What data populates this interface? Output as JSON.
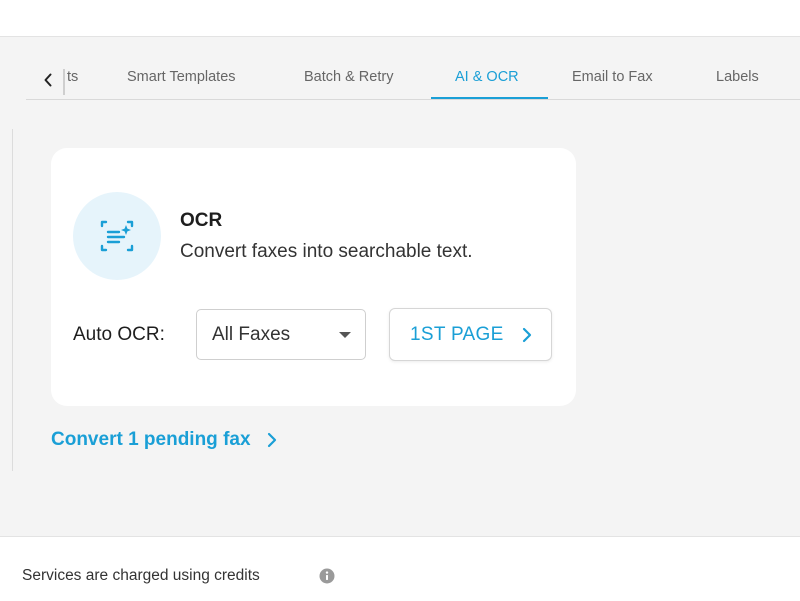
{
  "tabs": {
    "back_icon": "chevron-left-icon",
    "items": [
      {
        "label": "ts"
      },
      {
        "label": "Smart Templates"
      },
      {
        "label": "Batch & Retry"
      },
      {
        "label": "AI & OCR",
        "active": true
      },
      {
        "label": "Email to Fax"
      },
      {
        "label": "Labels"
      }
    ]
  },
  "ocr_card": {
    "icon": "ocr-scan-icon",
    "title": "OCR",
    "description": "Convert faxes into searchable text.",
    "auto_ocr_label": "Auto OCR:",
    "auto_ocr_value": "All Faxes",
    "page_button_label": "1ST PAGE"
  },
  "convert_link": {
    "label": "Convert 1 pending fax"
  },
  "footer": {
    "text": "Services are charged using credits",
    "info_icon": "info-icon"
  },
  "colors": {
    "accent": "#1a9fd6",
    "panel_background": "#f4f4f4",
    "icon_circle": "#e6f4fb"
  }
}
